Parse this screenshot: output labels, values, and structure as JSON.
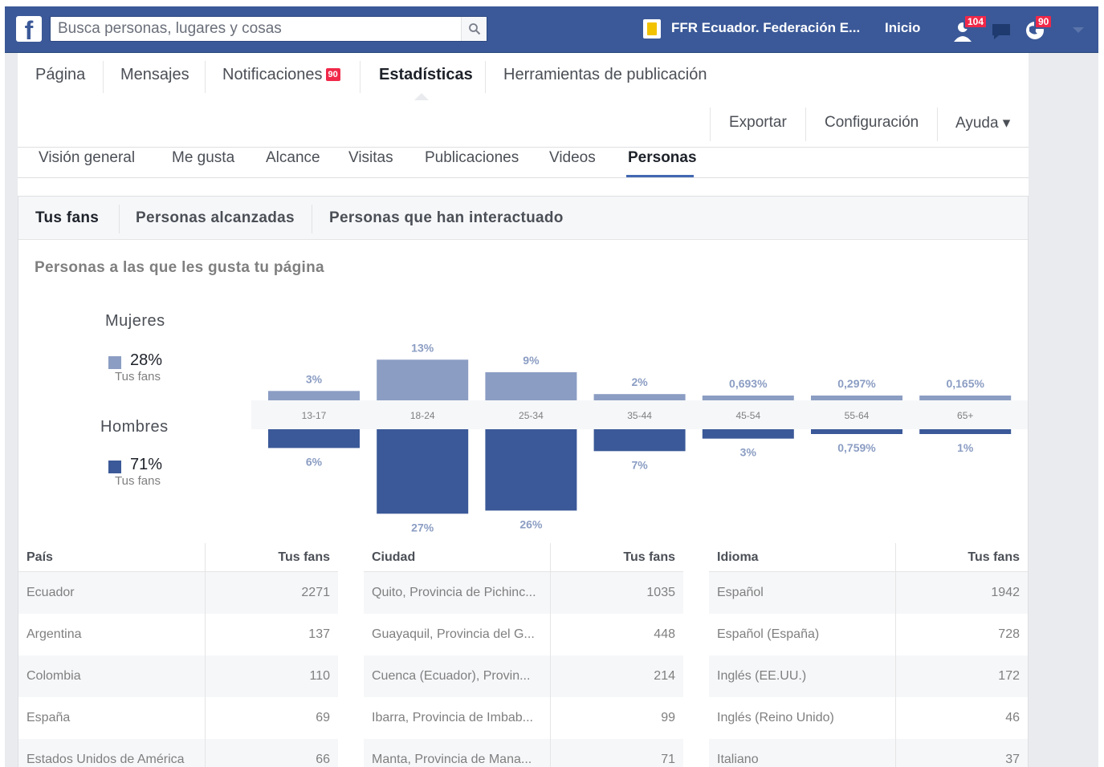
{
  "topbar": {
    "search_placeholder": "Busca personas, lugares y cosas",
    "page_name": "FFR Ecuador. Federación E...",
    "home": "Inicio",
    "friend_requests_count": "104",
    "notifications_count": "90",
    "icons": [
      "facebook-logo-icon",
      "search-icon",
      "page-icon",
      "friend-requests-icon",
      "messages-icon",
      "globe-notifications-icon",
      "chevron-down-icon"
    ],
    "brand_color": "#3b5998"
  },
  "page_tabs": {
    "items": [
      "Página",
      "Mensajes",
      "Notificaciones",
      "Estadísticas",
      "Herramientas de publicación"
    ],
    "notifications_badge": "90",
    "active": "Estadísticas"
  },
  "header_tools": {
    "export": "Exportar",
    "settings": "Configuración",
    "help": "Ayuda ▾"
  },
  "insights_nav": {
    "items": [
      "Visión general",
      "Me gusta",
      "Alcance",
      "Visitas",
      "Publicaciones",
      "Videos",
      "Personas"
    ],
    "active": "Personas"
  },
  "subtabs": {
    "items": [
      "Tus fans",
      "Personas alcanzadas",
      "Personas que han interactuado"
    ],
    "active": "Tus fans"
  },
  "section_title": "Personas a las que les gusta tu página",
  "legend": {
    "women_label": "Mujeres",
    "women_pct": "28%",
    "women_sub": "Tus fans",
    "men_label": "Hombres",
    "men_pct": "71%",
    "men_sub": "Tus fans",
    "women_color": "#8b9dc3",
    "men_color": "#3b5998"
  },
  "chart_data": {
    "type": "bar",
    "categories": [
      "13-17",
      "18-24",
      "25-34",
      "35-44",
      "45-54",
      "55-64",
      "65+"
    ],
    "series": [
      {
        "name": "Mujeres",
        "values": [
          3,
          13,
          9,
          2,
          0.693,
          0.297,
          0.165
        ],
        "labels": [
          "3%",
          "13%",
          "9%",
          "2%",
          "0,693%",
          "0,297%",
          "0,165%"
        ]
      },
      {
        "name": "Hombres",
        "values": [
          6,
          27,
          26,
          7,
          3,
          0.759,
          1
        ],
        "labels": [
          "6%",
          "27%",
          "26%",
          "7%",
          "3%",
          "0,759%",
          "1%"
        ]
      }
    ]
  },
  "tables": [
    {
      "name": "pais",
      "headers": [
        "País",
        "Tus fans"
      ],
      "rows": [
        [
          "Ecuador",
          "2271"
        ],
        [
          "Argentina",
          "137"
        ],
        [
          "Colombia",
          "110"
        ],
        [
          "España",
          "69"
        ],
        [
          "Estados Unidos de América",
          "66"
        ]
      ]
    },
    {
      "name": "ciudad",
      "headers": [
        "Ciudad",
        "Tus fans"
      ],
      "rows": [
        [
          "Quito, Provincia de Pichinc...",
          "1035"
        ],
        [
          "Guayaquil, Provincia del G...",
          "448"
        ],
        [
          "Cuenca (Ecuador), Provin...",
          "214"
        ],
        [
          "Ibarra, Provincia de Imbab...",
          "99"
        ],
        [
          "Manta, Provincia de Mana...",
          "71"
        ]
      ]
    },
    {
      "name": "idioma",
      "headers": [
        "Idioma",
        "Tus fans"
      ],
      "rows": [
        [
          "Español",
          "1942"
        ],
        [
          "Español (España)",
          "728"
        ],
        [
          "Inglés (EE.UU.)",
          "172"
        ],
        [
          "Inglés (Reino Unido)",
          "46"
        ],
        [
          "Italiano",
          "37"
        ]
      ]
    }
  ]
}
